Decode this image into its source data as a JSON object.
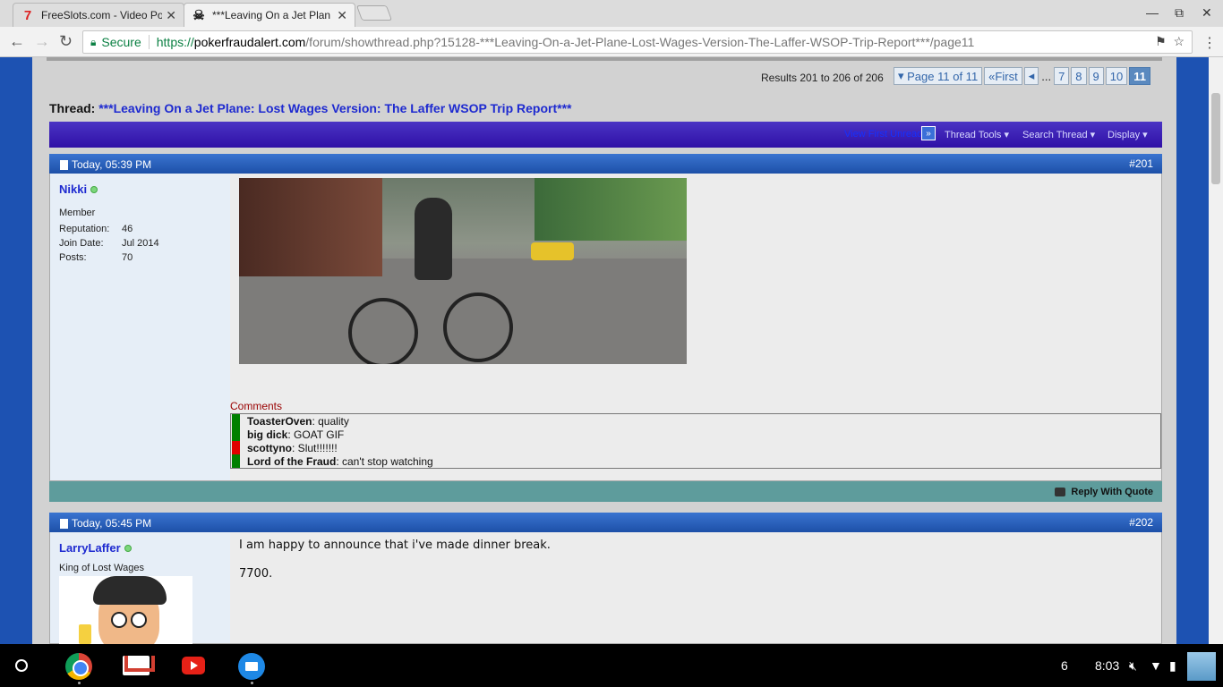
{
  "browser": {
    "tabs": [
      {
        "title": "FreeSlots.com - Video Po",
        "favicon": "slot-seven-icon"
      },
      {
        "title": "***Leaving On a Jet Plan",
        "favicon": "skull-icon"
      }
    ],
    "secure_label": "Secure",
    "url_scheme": "https://",
    "url_host": "pokerfraudalert.com",
    "url_path": "/forum/showthread.php?15128-***Leaving-On-a-Jet-Plane-Lost-Wages-Version-The-Laffer-WSOP-Trip-Report***/page11"
  },
  "forum": {
    "results": "Results 201 to 206 of 206",
    "pager": {
      "page_label": "Page 11 of 11",
      "first_label": "First",
      "ellipsis": "...",
      "pages": [
        "7",
        "8",
        "9",
        "10"
      ],
      "current": "11"
    },
    "thread_prefix": "Thread:",
    "thread_title": "***Leaving On a Jet Plane: Lost Wages Version: The Laffer WSOP Trip Report***",
    "tools": {
      "view_first_unread": "View First Unread",
      "thread_tools": "Thread Tools",
      "search_thread": "Search Thread",
      "display": "Display"
    },
    "posts": [
      {
        "date": "Today, 05:39 PM",
        "number": "#201",
        "username": "Nikki",
        "user_title": "Member",
        "stats": [
          {
            "label": "Reputation:",
            "value": "46"
          },
          {
            "label": "Join Date:",
            "value": "Jul 2014"
          },
          {
            "label": "Posts:",
            "value": "70"
          }
        ],
        "comments_label": "Comments",
        "comments": [
          {
            "user": "ToasterOven",
            "text": ": quality",
            "color": "#008000"
          },
          {
            "user": "big dick",
            "text": ": GOAT GIF",
            "color": "#008000"
          },
          {
            "user": "scottyno",
            "text": ": Slut!!!!!!!",
            "color": "#e00000"
          },
          {
            "user": "Lord of the Fraud",
            "text": ": can't stop watching",
            "color": "#008000"
          }
        ],
        "reply_label": "Reply With Quote"
      },
      {
        "date": "Today, 05:45 PM",
        "number": "#202",
        "username": "LarryLaffer",
        "user_title": "King of Lost Wages",
        "lines": [
          "I am happy to announce that i've made dinner break.",
          "7700."
        ]
      }
    ]
  },
  "shelf": {
    "notification_count": "6",
    "time": "8:03"
  }
}
